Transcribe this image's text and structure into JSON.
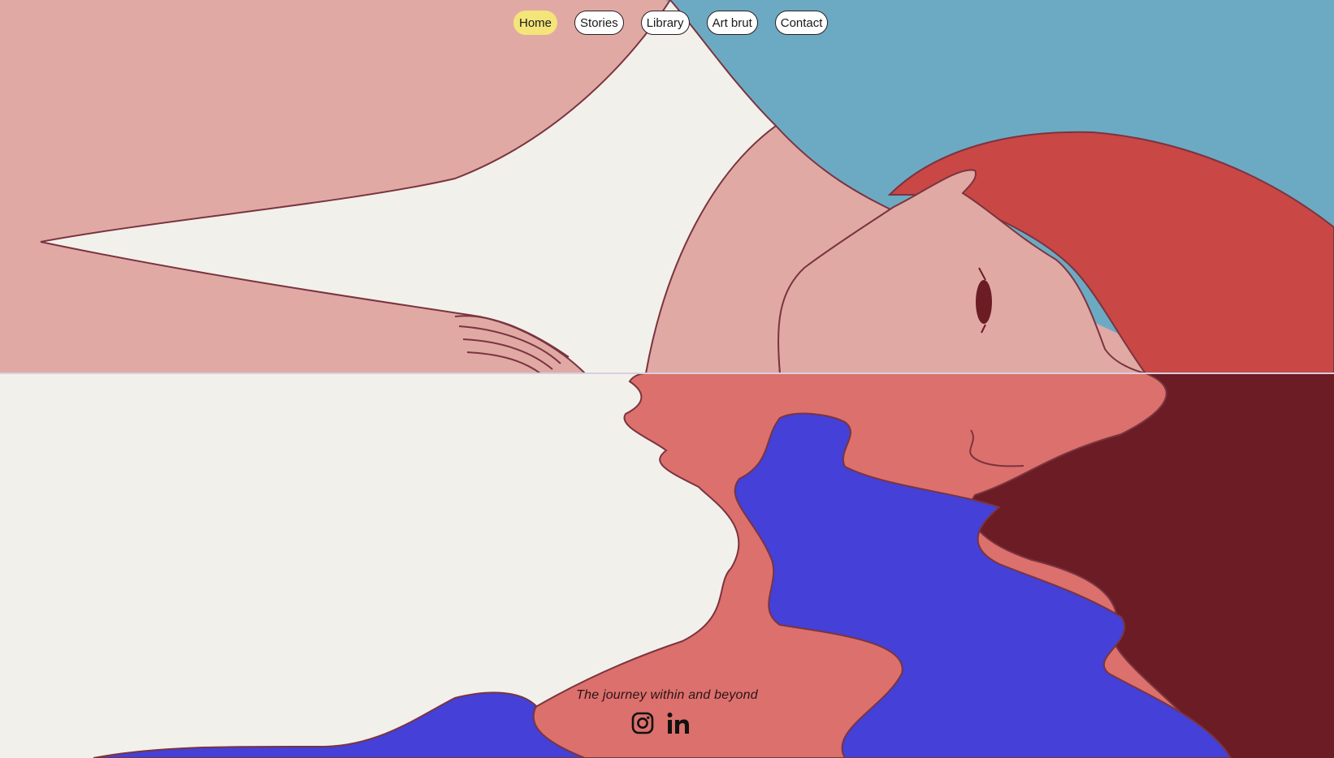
{
  "nav": {
    "items": [
      {
        "label": "Home",
        "active": true
      },
      {
        "label": "Stories",
        "active": false
      },
      {
        "label": "Library",
        "active": false
      },
      {
        "label": "Art brut",
        "active": false
      },
      {
        "label": "Contact",
        "active": false
      }
    ],
    "active_color": "#f3e57a"
  },
  "footer": {
    "tagline": "The journey within and beyond",
    "social": [
      {
        "icon": "instagram-icon"
      },
      {
        "icon": "linkedin-icon"
      }
    ]
  },
  "colors": {
    "pink": "#e1a9a4",
    "sky": "#6caac3",
    "cream": "#f2f0ea",
    "hair": "#c94745",
    "reflection_salmon": "#dc706c",
    "reflection_blue": "#4440d8",
    "reflection_maroon": "#6b1c24",
    "outline": "#7a3440"
  }
}
